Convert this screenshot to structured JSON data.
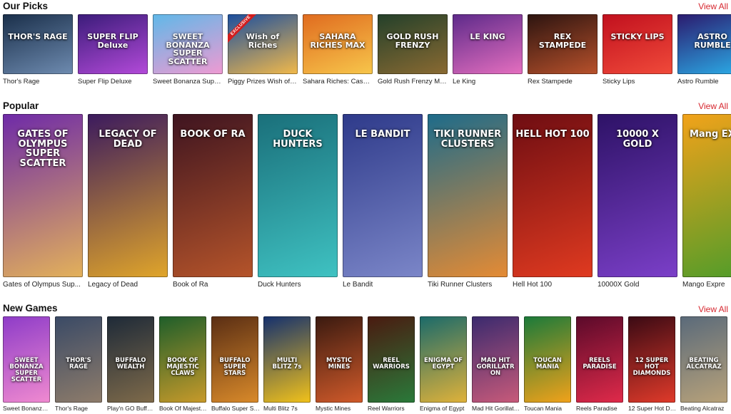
{
  "sections": {
    "picks": {
      "title": "Our Picks",
      "view_all": "View All",
      "games": [
        {
          "name": "Thor's Rage",
          "art": "THOR'S RAGE",
          "bg": [
            "#1a2f4a",
            "#6e8bb0"
          ]
        },
        {
          "name": "Super Flip Deluxe",
          "art": "SUPER FLIP Deluxe",
          "bg": [
            "#3b1c7a",
            "#b34ad9"
          ]
        },
        {
          "name": "Sweet Bonanza Super ...",
          "art": "SWEET BONANZA SUPER SCATTER",
          "bg": [
            "#5fb8e8",
            "#ef9ad2"
          ]
        },
        {
          "name": "Piggy Prizes Wish of R...",
          "art": "Wish of Riches",
          "bg": [
            "#1c4f9e",
            "#f2b94a"
          ],
          "exclusive": "EXCLUSIVE"
        },
        {
          "name": "Sahara Riches: Cash C...",
          "art": "SAHARA RICHES MAX",
          "bg": [
            "#e06b1f",
            "#f7c64b"
          ]
        },
        {
          "name": "Gold Rush Frenzy Meg...",
          "art": "GOLD RUSH FRENZY",
          "bg": [
            "#23402a",
            "#8a6a32"
          ]
        },
        {
          "name": "Le King",
          "art": "LE KING",
          "bg": [
            "#5d2a8a",
            "#e56fbf"
          ]
        },
        {
          "name": "Rex Stampede",
          "art": "REX STAMPEDE",
          "bg": [
            "#2c1410",
            "#b8512b"
          ]
        },
        {
          "name": "Sticky Lips",
          "art": "STICKY LIPS",
          "bg": [
            "#c1101e",
            "#f04a3a"
          ]
        },
        {
          "name": "Astro Rumble",
          "art": "ASTRO RUMBLE",
          "bg": [
            "#2b1a6e",
            "#2bb0ea"
          ]
        }
      ]
    },
    "popular": {
      "title": "Popular",
      "view_all": "View All",
      "games": [
        {
          "name": "Gates of Olympus Sup...",
          "art": "GATES OF OLYMPUS SUPER SCATTER",
          "bg": [
            "#6e2aa8",
            "#e3b15a"
          ]
        },
        {
          "name": "Legacy of Dead",
          "art": "LEGACY OF DEAD",
          "bg": [
            "#3b1a5e",
            "#e0a52a"
          ]
        },
        {
          "name": "Book of Ra",
          "art": "BOOK OF RA",
          "bg": [
            "#3e1420",
            "#b5542a"
          ]
        },
        {
          "name": "Duck Hunters",
          "art": "DUCK HUNTERS",
          "bg": [
            "#1a6f7a",
            "#3fc2c2"
          ]
        },
        {
          "name": "Le Bandit",
          "art": "LE BANDIT",
          "bg": [
            "#2e3a8a",
            "#7b86c8"
          ]
        },
        {
          "name": "Tiki Runner Clusters",
          "art": "TIKI RUNNER CLUSTERS",
          "bg": [
            "#1d6b8a",
            "#e58b34"
          ]
        },
        {
          "name": "Hell Hot 100",
          "art": "HELL HOT 100",
          "bg": [
            "#6e0d12",
            "#e03a20"
          ]
        },
        {
          "name": "10000X Gold",
          "art": "10000 X GOLD",
          "bg": [
            "#2d1266",
            "#7b3fc8"
          ]
        },
        {
          "name": "Mango Expre",
          "art": "Mang EXPRE",
          "bg": [
            "#f2a21a",
            "#4c9c2a"
          ]
        }
      ]
    },
    "newgames": {
      "title": "New Games",
      "view_all": "View All",
      "games": [
        {
          "name": "Sweet Bonanza S...",
          "art": "SWEET BONANZA SUPER SCATTER",
          "bg": [
            "#8e3cc8",
            "#f08ad0"
          ]
        },
        {
          "name": "Thor's Rage",
          "art": "THOR'S RAGE",
          "bg": [
            "#3a4a66",
            "#8e7c6a"
          ]
        },
        {
          "name": "Play'n GO Buffal...",
          "art": "BUFFALO WEALTH",
          "bg": [
            "#1e2a38",
            "#7e6a4a"
          ]
        },
        {
          "name": "Book Of Majestic...",
          "art": "BOOK OF MAJESTIC CLAWS",
          "bg": [
            "#1e5e2a",
            "#c89a2a"
          ]
        },
        {
          "name": "Buffalo Super Stars",
          "art": "BUFFALO SUPER STARS",
          "bg": [
            "#5a2e14",
            "#d98a2a"
          ]
        },
        {
          "name": "Multi Blitz 7s",
          "art": "MULTI BLITZ 7s",
          "bg": [
            "#14306e",
            "#f2c21a"
          ]
        },
        {
          "name": "Mystic Mines",
          "art": "MYSTIC MINES",
          "bg": [
            "#3a1a10",
            "#d05a2a"
          ]
        },
        {
          "name": "Reel Warriors",
          "art": "REEL WARRIORS",
          "bg": [
            "#4a1a10",
            "#2a7a3a"
          ]
        },
        {
          "name": "Enigma of Egypt",
          "art": "ENIGMA OF EGYPT",
          "bg": [
            "#1a6a6a",
            "#e0b23a"
          ]
        },
        {
          "name": "Mad Hit Gorillatr...",
          "art": "MAD HIT GORILLATRON",
          "bg": [
            "#3a2a6e",
            "#c85a7a"
          ]
        },
        {
          "name": "Toucan Mania",
          "art": "TOUCAN MANIA",
          "bg": [
            "#1a7a3a",
            "#f2a21a"
          ]
        },
        {
          "name": "Reels Paradise",
          "art": "REELS PARADISE",
          "bg": [
            "#5a0a2a",
            "#e02a4a"
          ]
        },
        {
          "name": "12 Super Hot Dia...",
          "art": "12 SUPER HOT DIAMONDS",
          "bg": [
            "#3a0a14",
            "#e03a2a"
          ]
        },
        {
          "name": "Beating Alcatraz",
          "art": "BEATING ALCATRAZ",
          "bg": [
            "#5a6a7a",
            "#b8a27a"
          ]
        }
      ]
    }
  }
}
